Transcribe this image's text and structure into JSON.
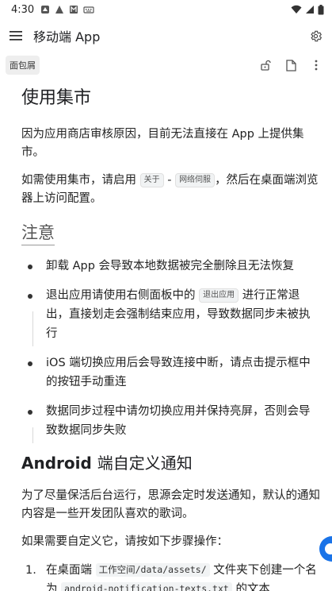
{
  "status_bar": {
    "time": "4:30",
    "left_icons": [
      "notification-icon",
      "app-a-icon",
      "app-m-icon",
      "keyboard-icon"
    ],
    "right_icons": [
      "wifi-icon",
      "signal-icon",
      "battery-icon"
    ]
  },
  "app_bar": {
    "title": "移动端 App"
  },
  "breadcrumb": {
    "label": "面包屑"
  },
  "doc": {
    "title": "使用集市",
    "p1": "因为应用商店审核原因，目前无法直接在 App 上提供集市。",
    "p2_before": "如需使用集市，请启用",
    "p2_chip1": "关于",
    "p2_dash": "-",
    "p2_chip2": "网络伺服",
    "p2_after": "，然后在桌面端浏览器上访问配置。",
    "note_title": "注意",
    "notes": [
      {
        "text": "卸载 App 会导致本地数据被完全删除且无法恢复"
      },
      {
        "before": "退出应用请使用右侧面板中的",
        "chip": "退出应用",
        "after": "进行正常退出，直接划走会强制结束应用，导致数据同步未被执行"
      },
      {
        "text": "iOS 端切换应用后会导致连接中断，请点击提示框中的按钮手动重连"
      },
      {
        "text": "数据同步过程中请勿切换应用并保持亮屏，否则会导致数据同步失败"
      }
    ],
    "section_title_bold": "Android",
    "section_title_rest": "端自定义通知",
    "p3": "为了尽量保活后台运行，思源会定时发送通知，默认的通知内容是一些开发团队喜欢的歌词。",
    "p4": "如果需要自定义它，请按如下步骤操作：",
    "steps": [
      {
        "num": "1.",
        "before": "在桌面端",
        "code1": "工作空间/data/assets/",
        "middle": "文件夹下创建一个名为",
        "code2": "android-notification-texts.txt",
        "after": "的文本"
      }
    ]
  },
  "colors": {
    "accent": "#1a73e8",
    "chip_bg": "#f1f3f4"
  }
}
